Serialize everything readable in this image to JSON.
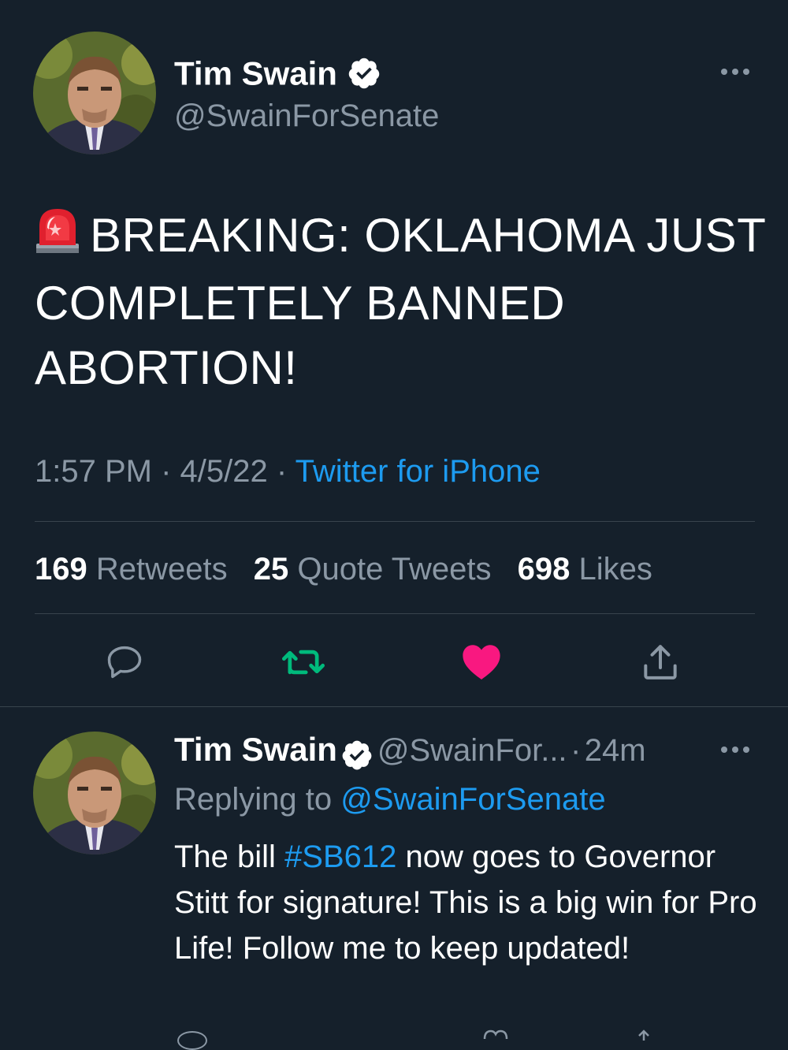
{
  "tweet": {
    "author_name": "Tim Swain",
    "author_handle": "@SwainForSenate",
    "text_line1": "BREAKING: OKLAHOMA JUST",
    "text_line2": "COMPLETELY BANNED",
    "text_line3": "ABORTION!",
    "time": "1:57 PM",
    "date": "4/5/22",
    "separator": "·",
    "source": "Twitter for iPhone",
    "stats": {
      "retweets_count": "169",
      "retweets_label": "Retweets",
      "quotes_count": "25",
      "quotes_label": "Quote Tweets",
      "likes_count": "698",
      "likes_label": "Likes"
    },
    "icons": [
      "siren-emoji",
      "verified-icon",
      "more-icon",
      "reply-icon",
      "retweet-icon",
      "heart-icon",
      "share-icon"
    ],
    "colors": {
      "background": "#15202b",
      "link": "#1d9bf0",
      "retweet": "#00ba7c",
      "like": "#f91880",
      "muted": "#8b98a5"
    }
  },
  "reply": {
    "author_name": "Tim Swain",
    "author_handle": "@SwainFor...",
    "separator": "·",
    "age": "24m",
    "replying_prefix": "Replying to",
    "replying_handle": "@SwainForSenate",
    "text_before": "The bill ",
    "hashtag": "#SB612",
    "text_after": " now goes to Governor Stitt for signature! This is a big win for Pro Life! Follow me to keep updated!"
  }
}
